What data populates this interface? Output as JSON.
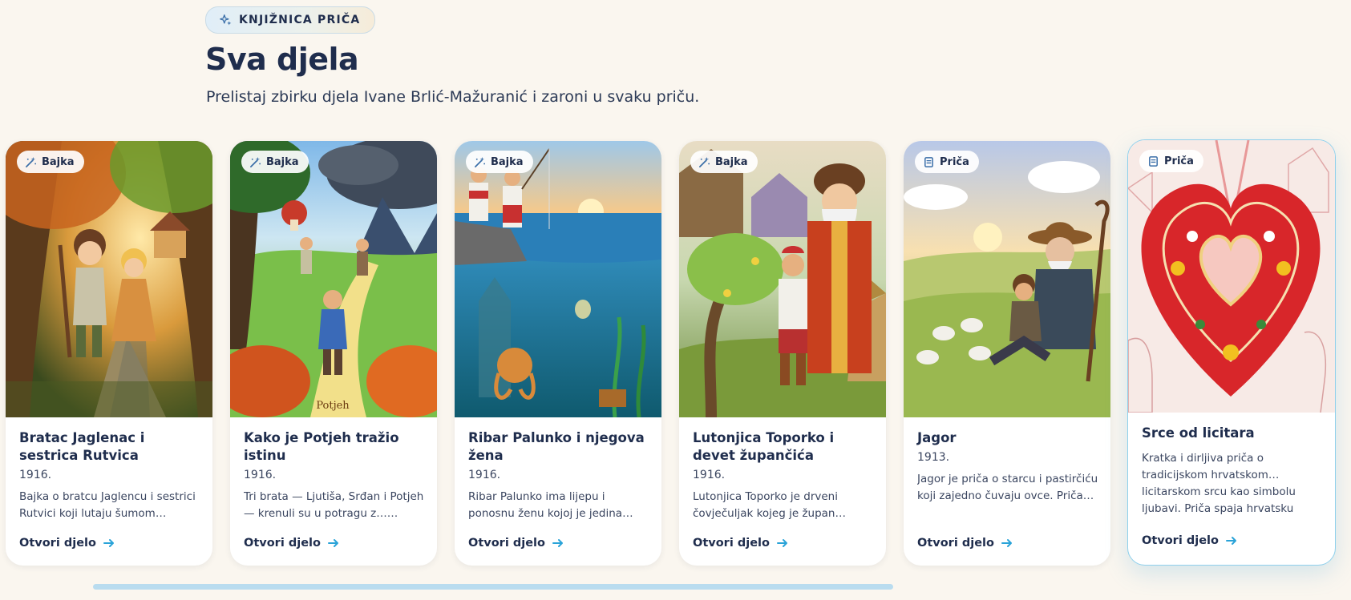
{
  "header": {
    "eyebrow": "KNJIŽNICA PRIČA",
    "title": "Sva djela",
    "subtitle": "Prelistaj zbirku djela Ivane Brlić-Mažuranić i zaroni u svaku priču."
  },
  "cards": [
    {
      "badge": "Bajka",
      "title": "Bratac Jaglenac i sestrica Rutvica",
      "year": "1916.",
      "description": "Bajka o bratcu Jaglencu i sestrici Rutvici koji lutaju šumom nakon…",
      "link": "Otvori djelo"
    },
    {
      "badge": "Bajka",
      "title": "Kako je Potjeh tražio istinu",
      "year": "1916.",
      "description": "Tri brata — Ljutiša, Srđan i Potjeh — krenuli su u potragu z… istinom. Svaki je od braće birao",
      "link": "Otvori djelo",
      "cover_caption": "Potjeh"
    },
    {
      "badge": "Bajka",
      "title": "Ribar Palunko i njegova žena",
      "year": "1916.",
      "description": "Ribar Palunko ima lijepu i ponosnu ženu kojoj je jedina žel…",
      "link": "Otvori djelo"
    },
    {
      "badge": "Bajka",
      "title": "Lutonjica Toporko i devet župančića",
      "year": "1916.",
      "description": "Lutonjica Toporko je drveni čovječuljak kojeg je župan…",
      "link": "Otvori djelo"
    },
    {
      "badge": "Priča",
      "title": "Jagor",
      "year": "1913.",
      "description": "Jagor je priča o starcu i pastirčiću koji zajedno čuvaju ovce. Priča o… međugeneracijskom prijateljstvu,",
      "link": "Otvori djelo"
    },
    {
      "badge": "Priča",
      "title": "Srce od licitara",
      "year": "",
      "description": "Kratka i dirljiva priča o tradicijskom hrvatskom… licitarskom srcu kao simbolu ljubavi. Priča spaja hrvatsku",
      "link": "Otvori djelo"
    }
  ],
  "icons": {
    "eyebrow": "sparkles-icon",
    "bajka": "magic-wand-icon",
    "prica": "scroll-icon",
    "link": "arrow-right-icon"
  },
  "colors": {
    "background": "#faf6ef",
    "text": "#1f2d4d",
    "accent": "#2aa3d8",
    "scrollbar": "#b9dcef"
  }
}
